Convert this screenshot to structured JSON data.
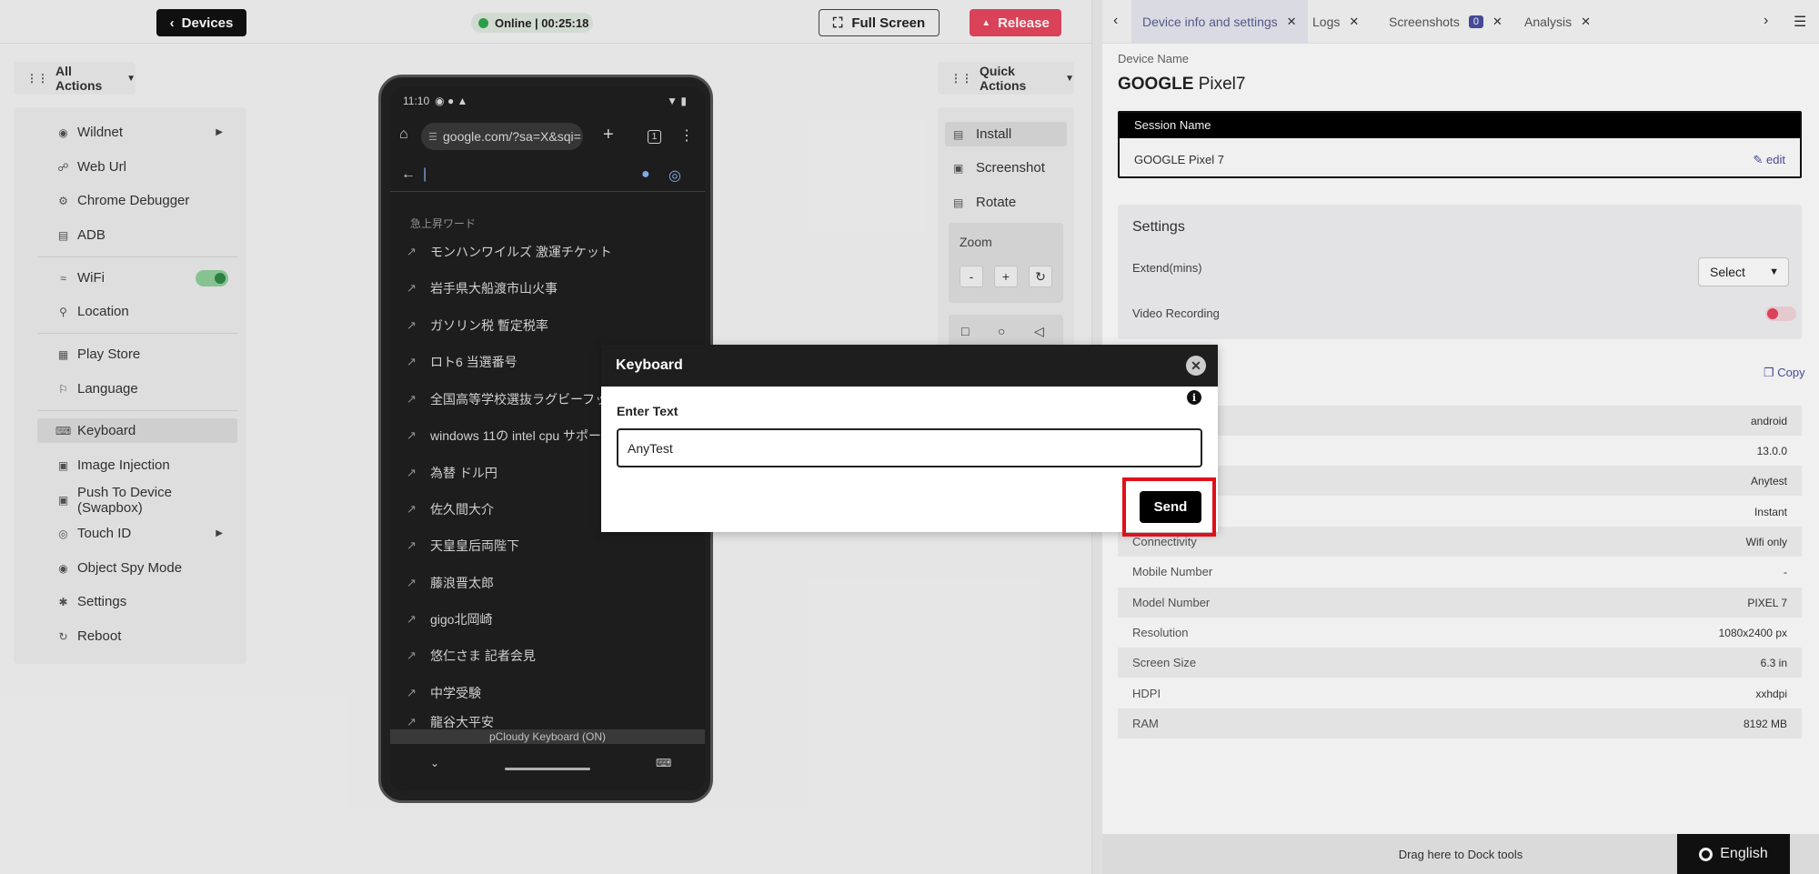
{
  "topbar": {
    "devices_label": "Devices",
    "status_text": "Online | 00:25:18",
    "fullscreen_label": "Full Screen",
    "release_label": "Release"
  },
  "sidebar": {
    "all_actions_label": "All Actions",
    "items": [
      {
        "label": "Wildnet",
        "icon": "wildnet-icon"
      },
      {
        "label": "Web Url",
        "icon": "link-icon"
      },
      {
        "label": "Chrome Debugger",
        "icon": "bug-icon"
      },
      {
        "label": "ADB",
        "icon": "terminal-icon"
      },
      {
        "label": "WiFi",
        "icon": "wifi-icon"
      },
      {
        "label": "Location",
        "icon": "location-icon"
      },
      {
        "label": "Play Store",
        "icon": "apps-icon"
      },
      {
        "label": "Language",
        "icon": "language-icon"
      },
      {
        "label": "Keyboard",
        "icon": "keyboard-icon"
      },
      {
        "label": "Image Injection",
        "icon": "image-icon"
      },
      {
        "label": "Push To Device (Swapbox)",
        "icon": "push-icon"
      },
      {
        "label": "Touch ID",
        "icon": "fingerprint-icon"
      },
      {
        "label": "Object Spy Mode",
        "icon": "spy-icon"
      },
      {
        "label": "Settings",
        "icon": "gear-icon"
      },
      {
        "label": "Reboot",
        "icon": "reboot-icon"
      }
    ]
  },
  "phone": {
    "time": "11:10",
    "url": "google.com/?sa=X&sqi=",
    "tab_count": "1",
    "trending_header": "急上昇ワード",
    "trends": [
      "モンハンワイルズ 激運チケット",
      "岩手県大船渡市山火事",
      "ガソリン税 暫定税率",
      "ロト6 当選番号",
      "全国高等学校選抜ラグビーフッ",
      "windows 11の intel cpu サポー",
      "為替 ドル円",
      "佐久間大介",
      "天皇皇后両陛下",
      "藤浪晋太郎",
      "gigo北岡崎",
      "悠仁さま 記者会見",
      "中学受験",
      "龍谷大平安"
    ],
    "keyboard_status": "pCloudy Keyboard (ON)"
  },
  "quick_actions": {
    "label": "Quick Actions",
    "items": [
      "Install",
      "Screenshot",
      "Rotate"
    ],
    "zoom_label": "Zoom",
    "zoom_minus": "-",
    "zoom_plus": "+"
  },
  "right_panel": {
    "tabs": [
      {
        "label": "Device info and settings"
      },
      {
        "label": "Logs"
      },
      {
        "label": "Screenshots",
        "badge": "0"
      },
      {
        "label": "Analysis"
      }
    ],
    "device_name_label": "Device Name",
    "device_brand": "GOOGLE",
    "device_model": "Pixel7",
    "session_name_label": "Session Name",
    "session_name_value": "GOOGLE Pixel 7",
    "edit_label": "edit",
    "settings_title": "Settings",
    "extend_label": "Extend(mins)",
    "extend_select": "Select",
    "video_recording_label": "Video Recording",
    "copy_label": "Copy",
    "info_rows": [
      {
        "label": "",
        "value": "android"
      },
      {
        "label": "",
        "value": "13.0.0"
      },
      {
        "label": "",
        "value": "Anytest"
      },
      {
        "label": "",
        "value": "Instant"
      },
      {
        "label": "Connectivity",
        "value": "Wifi only"
      },
      {
        "label": "Mobile Number",
        "value": "-"
      },
      {
        "label": "Model Number",
        "value": "PIXEL 7"
      },
      {
        "label": "Resolution",
        "value": "1080x2400 px"
      },
      {
        "label": "Screen Size",
        "value": "6.3 in"
      },
      {
        "label": "HDPI",
        "value": "xxhdpi"
      },
      {
        "label": "RAM",
        "value": "8192 MB"
      }
    ],
    "dock_label": "Drag here to Dock tools",
    "language_label": "English"
  },
  "modal": {
    "title": "Keyboard",
    "input_label": "Enter Text",
    "input_value": "AnyTest",
    "send_label": "Send"
  },
  "colors": {
    "release": "#e8475f",
    "online_dot": "#2fa84f",
    "accent": "#4b4fa0",
    "highlight": "#e0101a"
  }
}
